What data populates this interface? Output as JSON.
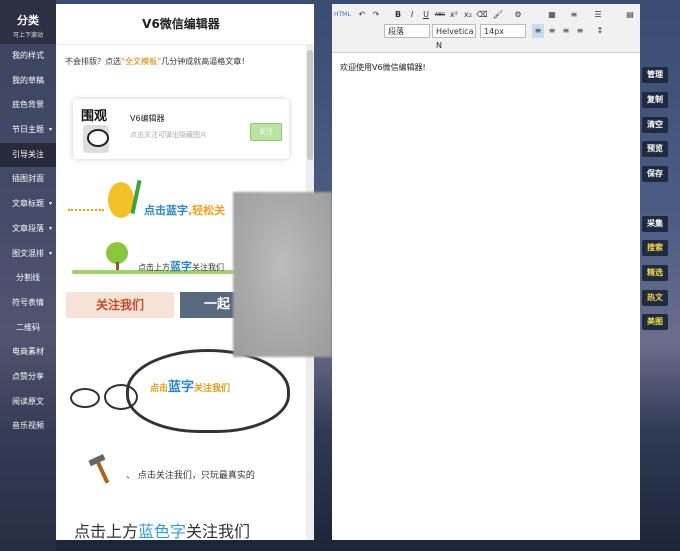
{
  "category": {
    "title": "分类",
    "subtitle": "可上下滚动",
    "items": [
      {
        "label": "我的样式"
      },
      {
        "label": "我的草稿"
      },
      {
        "label": "底色背景"
      },
      {
        "label": "节日主题",
        "arrow": "▾"
      },
      {
        "label": "引导关注",
        "active": true
      },
      {
        "label": "插图封面"
      },
      {
        "label": "文章标题",
        "arrow": "▾"
      },
      {
        "label": "文章段落",
        "arrow": "▾"
      },
      {
        "label": "图文混排",
        "arrow": "▾"
      },
      {
        "label": "分割线"
      },
      {
        "label": "符号表情"
      },
      {
        "label": "二维码"
      },
      {
        "label": "电商素材"
      },
      {
        "label": "点赞分享"
      },
      {
        "label": "阅读原文"
      },
      {
        "label": "音乐视频"
      }
    ]
  },
  "templates": {
    "title": "V6微信编辑器",
    "hint_prefix": "不会排版？点选",
    "hint_highlight": "“全文模板”",
    "hint_suffix": "几分钟成就高逼格文章！",
    "card": {
      "logo": "围观",
      "name": "V6编辑器",
      "subtitle": "点击关注可弹出隐藏图片",
      "button": "关注"
    },
    "tile1_text_a": "点击蓝字",
    "tile1_text_b": ",轻松关",
    "tile2_text_a": "点击上方",
    "tile2_text_b": "蓝字",
    "tile2_text_c": "关注我们",
    "tile3_left": "关注我们",
    "tile3_right": "一起",
    "tile4_text_a": "点击",
    "tile4_text_b": "蓝字",
    "tile4_text_c": "关注我们",
    "tile5_dot": "、",
    "tile5_text": "点击关注我们，只玩最真实的",
    "tile6_text_a": "点击上方",
    "tile6_text_b": "蓝色字",
    "tile6_text_c": "关注我们"
  },
  "editor": {
    "toolbar_row1": [
      "HTML",
      "↶",
      "↷",
      "B",
      "I",
      "U",
      "ABC",
      "x²",
      "x₂",
      "⌫",
      "🖌",
      "⚙",
      "▦",
      "≡",
      "☰",
      "▤"
    ],
    "toolbar_row2_selects": {
      "paragraph": "段落",
      "font": "Helvetica N",
      "size": "14px"
    },
    "content": "欢迎使用V6微信编辑器!"
  },
  "right_buttons": [
    {
      "label": "管理"
    },
    {
      "label": "复制"
    },
    {
      "label": "清空"
    },
    {
      "label": "预览"
    },
    {
      "label": "保存"
    },
    {
      "label": "采集"
    },
    {
      "label": "搜索"
    },
    {
      "label": "精选"
    },
    {
      "label": "热文"
    },
    {
      "label": "美图"
    }
  ]
}
